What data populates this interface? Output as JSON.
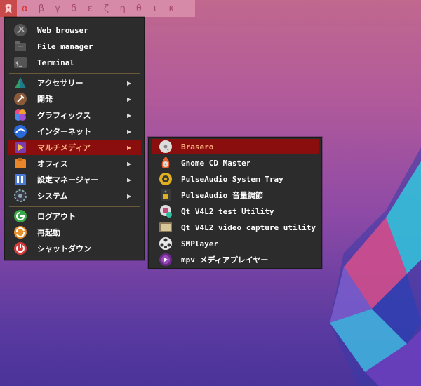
{
  "taskbar": {
    "workspaces": [
      "α",
      "β",
      "γ",
      "δ",
      "ε",
      "ζ",
      "η",
      "θ",
      "ι",
      "κ"
    ]
  },
  "main_menu": {
    "items": [
      {
        "label": "Web browser",
        "icon": "globe-icon"
      },
      {
        "label": "File manager",
        "icon": "folder-icon"
      },
      {
        "label": "Terminal",
        "icon": "terminal-icon"
      },
      {
        "label": "アクセサリー",
        "icon": "accessories-icon",
        "arrow": "▶"
      },
      {
        "label": "開発",
        "icon": "development-icon",
        "arrow": "▶"
      },
      {
        "label": "グラフィックス",
        "icon": "graphics-icon",
        "arrow": "▶"
      },
      {
        "label": "インターネット",
        "icon": "internet-icon",
        "arrow": "▶"
      },
      {
        "label": "マルチメディア",
        "icon": "multimedia-icon",
        "arrow": "▶"
      },
      {
        "label": "オフィス",
        "icon": "office-icon",
        "arrow": "▶"
      },
      {
        "label": "設定マネージャー",
        "icon": "settings-manager-icon",
        "arrow": "▶"
      },
      {
        "label": "システム",
        "icon": "system-icon",
        "arrow": "▶"
      },
      {
        "label": "ログアウト",
        "icon": "logout-icon"
      },
      {
        "label": "再起動",
        "icon": "restart-icon"
      },
      {
        "label": "シャットダウン",
        "icon": "shutdown-icon"
      }
    ]
  },
  "submenu": {
    "items": [
      {
        "label": "Brasero",
        "icon": "brasero-icon"
      },
      {
        "label": "Gnome CD Master",
        "icon": "cd-master-icon"
      },
      {
        "label": "PulseAudio System Tray",
        "icon": "pulseaudio-tray-icon"
      },
      {
        "label": "PulseAudio 音量調節",
        "icon": "speaker-icon"
      },
      {
        "label": "Qt V4L2 test Utility",
        "icon": "webcam-icon"
      },
      {
        "label": "Qt V4L2 video capture utility",
        "icon": "video-capture-icon"
      },
      {
        "label": "SMPlayer",
        "icon": "smplayer-icon"
      },
      {
        "label": "mpv メディアプレイヤー",
        "icon": "mpv-icon"
      }
    ]
  },
  "colors": {
    "menu_bg": "#2c2c2c",
    "highlight_bg": "#8a0e0e",
    "highlight_text": "#ffb080",
    "topbar": "#d78aa8"
  }
}
